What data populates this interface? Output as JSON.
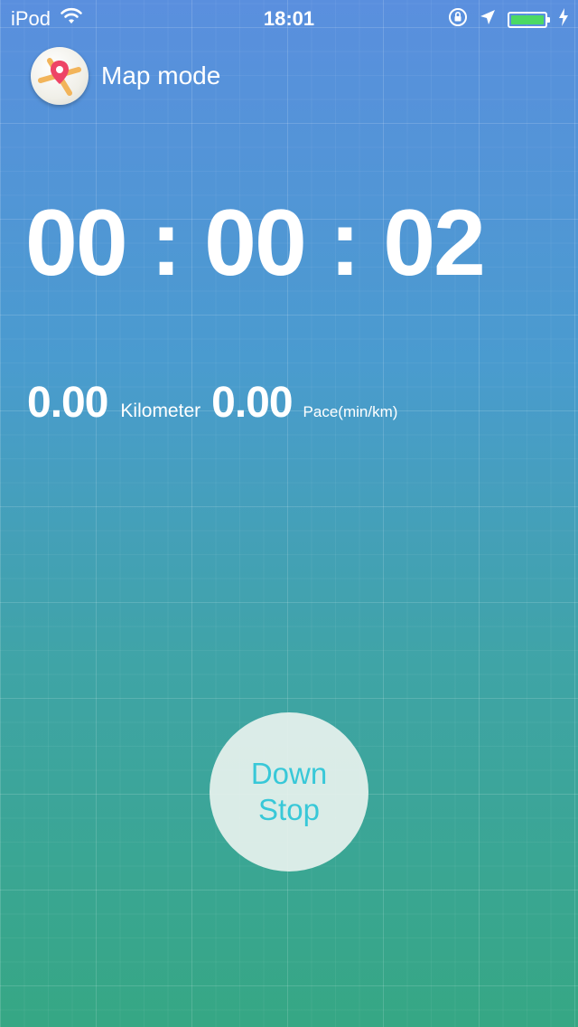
{
  "status_bar": {
    "carrier": "iPod",
    "time": "18:01",
    "battery_level": 1.0,
    "icons": [
      "wifi-icon",
      "orientation-lock-icon",
      "location-arrow-icon",
      "battery-icon",
      "charging-bolt-icon"
    ]
  },
  "header": {
    "map_mode_label": "Map mode",
    "icon": "map-pin-icon"
  },
  "timer": {
    "display": "00 : 00 : 02"
  },
  "stats": {
    "distance_value": "0.00",
    "distance_unit": "Kilometer",
    "pace_value": "0.00",
    "pace_unit": "Pace(min/km)"
  },
  "action_button": {
    "line1": "Down",
    "line2": "Stop"
  },
  "colors": {
    "gradient_top": "#5a8fde",
    "gradient_bottom": "#36a784",
    "button_text": "#38c8d8",
    "battery_fill": "#4cd964"
  }
}
